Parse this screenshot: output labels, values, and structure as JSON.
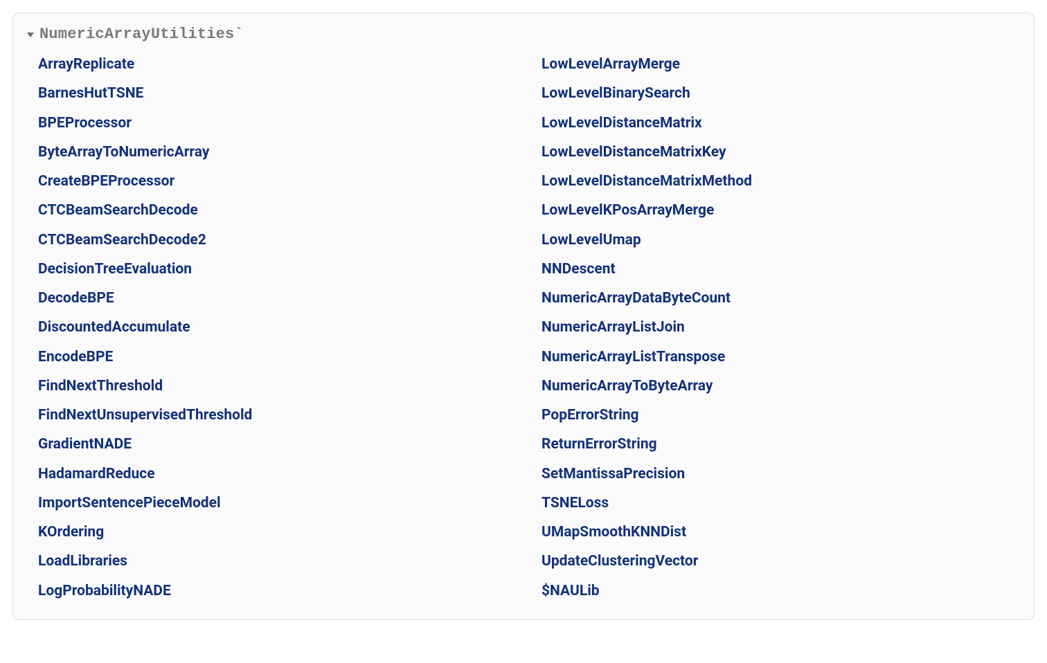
{
  "section": {
    "title": "NumericArrayUtilities`",
    "left": [
      "ArrayReplicate",
      "BarnesHutTSNE",
      "BPEProcessor",
      "ByteArrayToNumericArray",
      "CreateBPEProcessor",
      "CTCBeamSearchDecode",
      "CTCBeamSearchDecode2",
      "DecisionTreeEvaluation",
      "DecodeBPE",
      "DiscountedAccumulate",
      "EncodeBPE",
      "FindNextThreshold",
      "FindNextUnsupervisedThreshold",
      "GradientNADE",
      "HadamardReduce",
      "ImportSentencePieceModel",
      "KOrdering",
      "LoadLibraries",
      "LogProbabilityNADE"
    ],
    "right": [
      "LowLevelArrayMerge",
      "LowLevelBinarySearch",
      "LowLevelDistanceMatrix",
      "LowLevelDistanceMatrixKey",
      "LowLevelDistanceMatrixMethod",
      "LowLevelKPosArrayMerge",
      "LowLevelUmap",
      "NNDescent",
      "NumericArrayDataByteCount",
      "NumericArrayListJoin",
      "NumericArrayListTranspose",
      "NumericArrayToByteArray",
      "PopErrorString",
      "ReturnErrorString",
      "SetMantissaPrecision",
      "TSNELoss",
      "UMapSmoothKNNDist",
      "UpdateClusteringVector",
      "$NAULib"
    ]
  }
}
